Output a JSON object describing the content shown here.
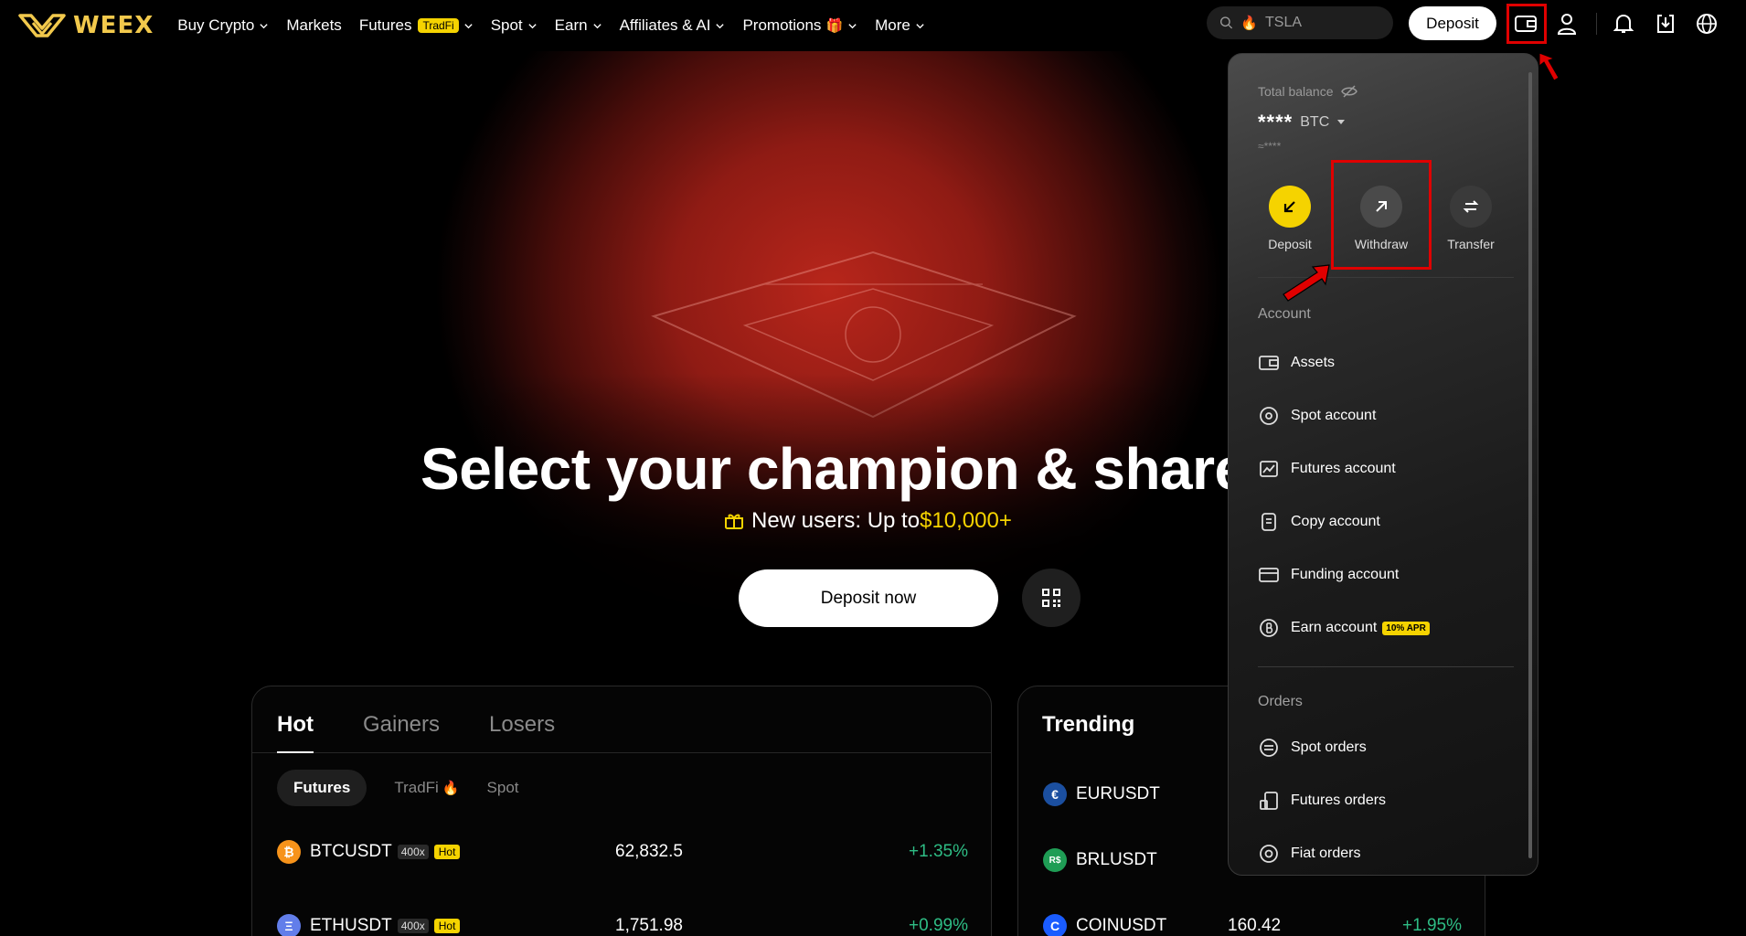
{
  "nav": {
    "brand": "WEEX",
    "items": [
      {
        "label": "Buy Crypto",
        "chevron": true
      },
      {
        "label": "Markets",
        "chevron": false
      },
      {
        "label": "Futures",
        "tag": "TradFi",
        "chevron": true
      },
      {
        "label": "Spot",
        "chevron": true
      },
      {
        "label": "Earn",
        "chevron": true
      },
      {
        "label": "Affiliates & AI",
        "chevron": true
      },
      {
        "label": "Promotions",
        "gift": "🎁",
        "chevron": true
      },
      {
        "label": "More",
        "chevron": true
      }
    ],
    "search_placeholder": "TSLA",
    "deposit_label": "Deposit"
  },
  "hero": {
    "title": "Select your champion & share $",
    "subtitle_prefix": "New users: Up to ",
    "subtitle_amount": "$10,000+",
    "cta": "Deposit now"
  },
  "market": {
    "tabs": [
      "Hot",
      "Gainers",
      "Losers"
    ],
    "subtabs": [
      "Futures",
      "TradFi",
      "Spot"
    ],
    "rows": [
      {
        "symbol": "BTCUSDT",
        "leverage": "400x",
        "tag": "Hot",
        "price": "62,832.5",
        "change": "+1.35%",
        "coin_color": "#f7931a",
        "coin_glyph": "₿"
      },
      {
        "symbol": "ETHUSDT",
        "leverage": "400x",
        "tag": "Hot",
        "price": "1,751.98",
        "change": "+0.99%",
        "coin_color": "#627eea",
        "coin_glyph": "Ξ"
      }
    ]
  },
  "trending": {
    "title": "Trending",
    "rows": [
      {
        "symbol": "EURUSDT",
        "price": "",
        "change": "",
        "coin_color": "#1b4fa0",
        "coin_glyph": "€"
      },
      {
        "symbol": "BRLUSDT",
        "price": "",
        "change": "",
        "coin_color": "#1f9d55",
        "coin_glyph": "R$"
      },
      {
        "symbol": "COINUSDT",
        "price": "160.42",
        "change": "+1.95%",
        "coin_color": "#1a5cff",
        "coin_glyph": "C"
      }
    ]
  },
  "wallet": {
    "total_balance_label": "Total balance",
    "balance_masked": "****",
    "currency": "BTC",
    "approx": "≈****",
    "actions": [
      {
        "label": "Deposit",
        "icon": "arrow-down-left-icon"
      },
      {
        "label": "Withdraw",
        "icon": "arrow-up-right-icon"
      },
      {
        "label": "Transfer",
        "icon": "transfer-icon"
      }
    ],
    "account_title": "Account",
    "account_items": [
      {
        "label": "Assets",
        "icon": "wallet-icon"
      },
      {
        "label": "Spot account",
        "icon": "spot-icon"
      },
      {
        "label": "Futures account",
        "icon": "futures-icon"
      },
      {
        "label": "Copy account",
        "icon": "copy-icon"
      },
      {
        "label": "Funding account",
        "icon": "card-icon"
      },
      {
        "label": "Earn account",
        "icon": "earn-icon",
        "badge": "10% APR"
      }
    ],
    "orders_title": "Orders",
    "order_items": [
      {
        "label": "Spot orders",
        "icon": "spot-orders-icon"
      },
      {
        "label": "Futures orders",
        "icon": "futures-orders-icon"
      },
      {
        "label": "Fiat orders",
        "icon": "fiat-orders-icon"
      }
    ]
  },
  "colors": {
    "accent_yellow": "#f5d300",
    "positive": "#2ebd85",
    "highlight_red": "#e00000"
  }
}
